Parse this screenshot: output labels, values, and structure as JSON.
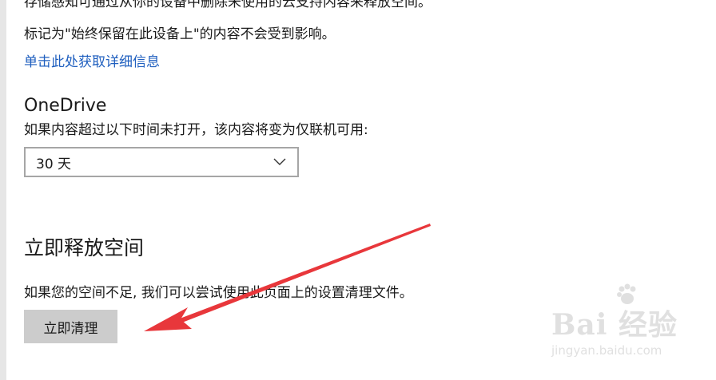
{
  "content": {
    "para1": "存储感知可通过从你的设备中删除未使用的云支持内容来释放空间。",
    "para2": "标记为\"始终保留在此设备上\"的内容不会受到影响。",
    "link": "单击此处获取详细信息"
  },
  "onedrive": {
    "heading": "OneDrive",
    "description": "如果内容超过以下时间未打开，该内容将变为仅联机可用:",
    "dropdown_value": "30 天"
  },
  "free_space": {
    "heading": "立即释放空间",
    "description": "如果您的空间不足, 我们可以尝试使用此页面上的设置清理文件。",
    "button_label": "立即清理"
  },
  "annotation": {
    "arrow_color": "#e8373b"
  },
  "watermark": {
    "main": "Bai  经验",
    "sub": "jingyan.baidu.com"
  }
}
